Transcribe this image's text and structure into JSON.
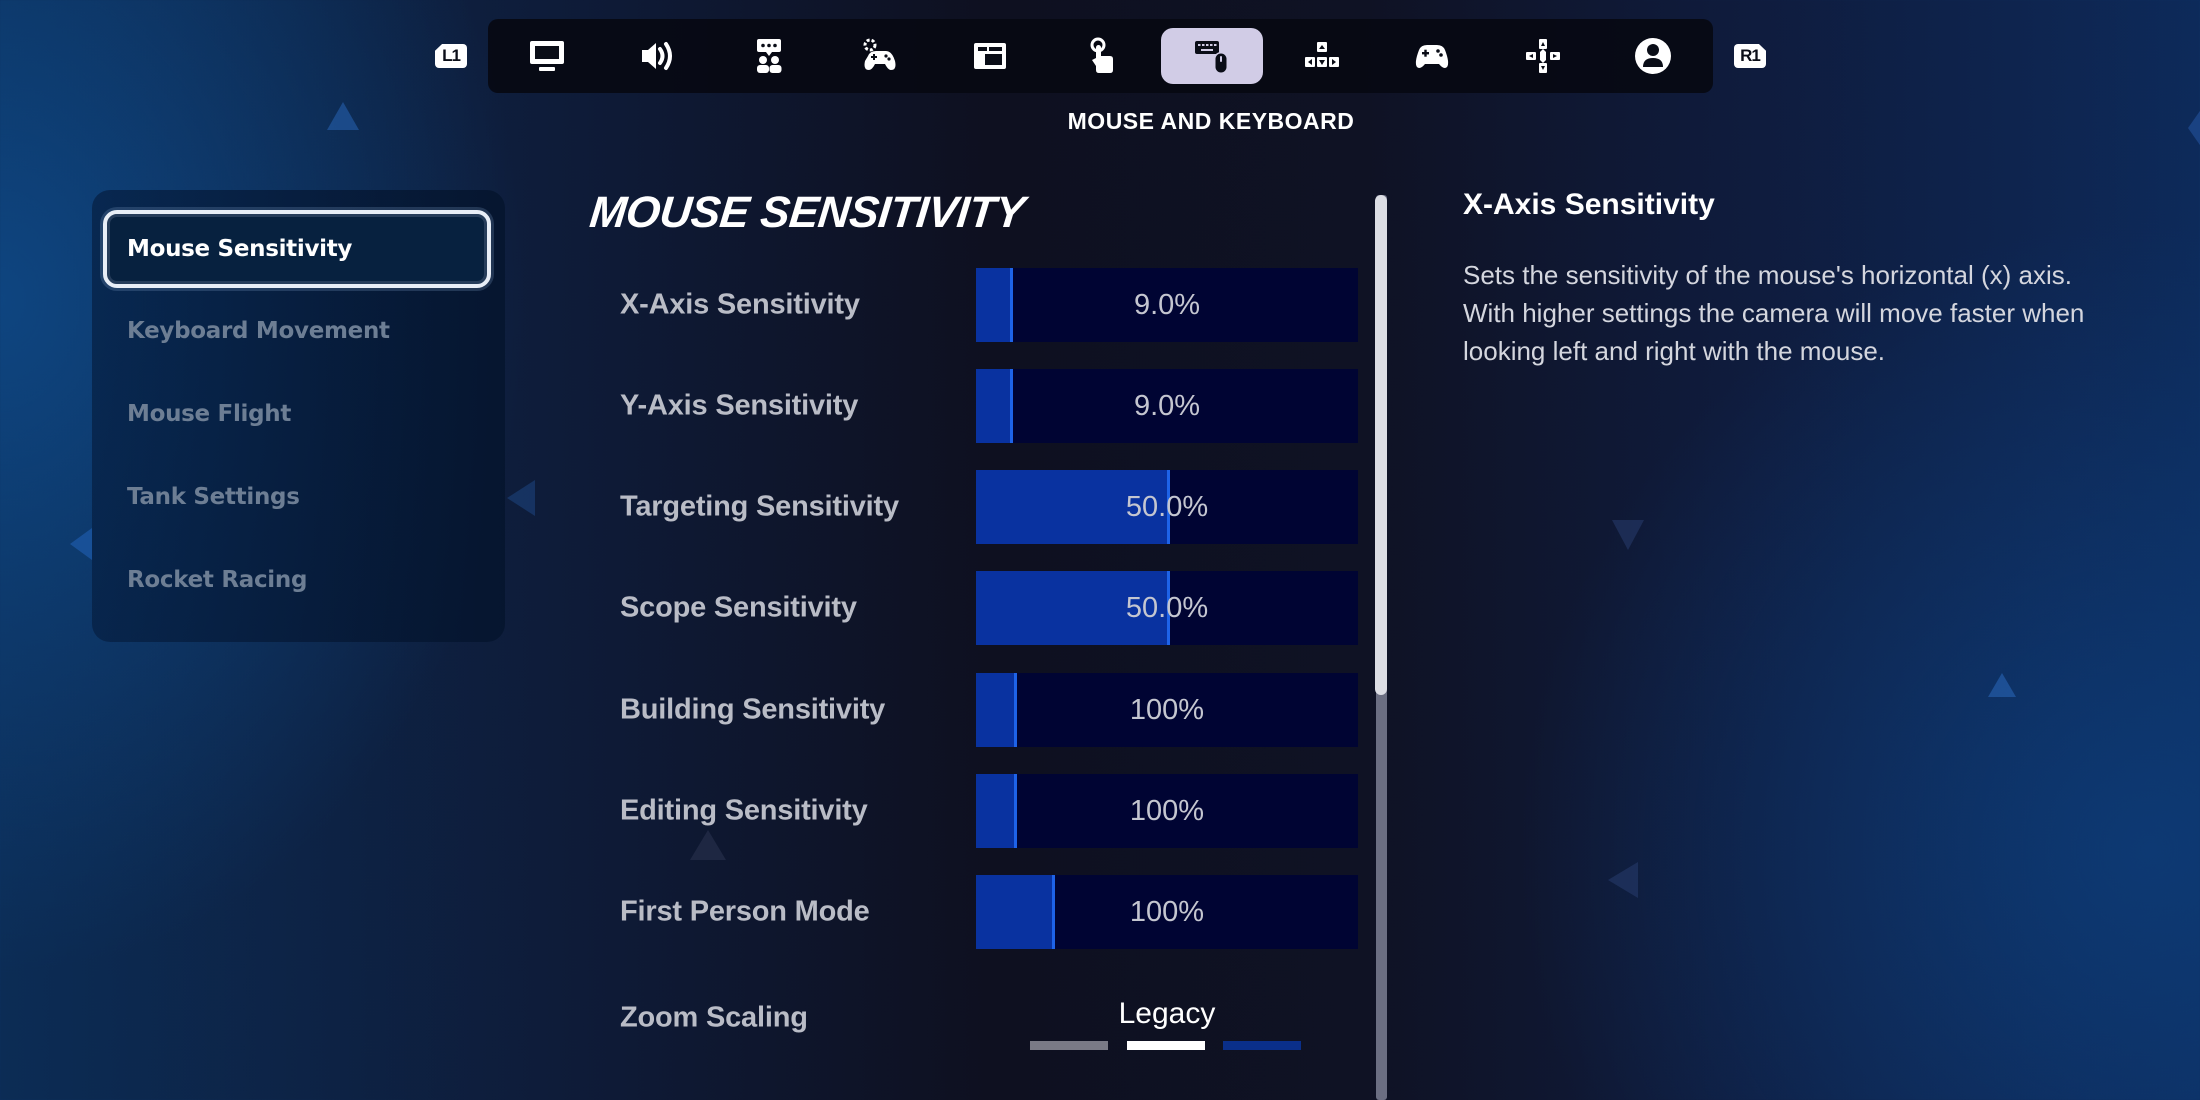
{
  "nav": {
    "left_shoulder": "L1",
    "right_shoulder": "R1",
    "tabs": [
      {
        "icon": "monitor-icon",
        "label": "Video",
        "active": false
      },
      {
        "icon": "speaker-icon",
        "label": "Audio",
        "active": false
      },
      {
        "icon": "accessibility-chat-icon",
        "label": "Accessibility",
        "active": false
      },
      {
        "icon": "controller-settings-icon",
        "label": "Game",
        "active": false
      },
      {
        "icon": "window-layout-icon",
        "label": "HUD",
        "active": false
      },
      {
        "icon": "touch-pointer-icon",
        "label": "Touch",
        "active": false
      },
      {
        "icon": "keyboard-mouse-icon",
        "label": "Mouse and Keyboard",
        "active": true
      },
      {
        "icon": "arrow-keys-icon",
        "label": "Keyboard Controls",
        "active": false
      },
      {
        "icon": "gamepad-icon",
        "label": "Controller",
        "active": false
      },
      {
        "icon": "dpad-icon",
        "label": "Controller Bindings",
        "active": false
      },
      {
        "icon": "account-icon",
        "label": "Account",
        "active": false
      }
    ],
    "active_title": "MOUSE AND KEYBOARD"
  },
  "sidebar": {
    "items": [
      {
        "label": "Mouse Sensitivity",
        "active": true
      },
      {
        "label": "Keyboard Movement",
        "active": false
      },
      {
        "label": "Mouse Flight",
        "active": false
      },
      {
        "label": "Tank Settings",
        "active": false
      },
      {
        "label": "Rocket Racing",
        "active": false
      }
    ]
  },
  "main": {
    "title": "MOUSE SENSITIVITY",
    "settings": [
      {
        "label": "X-Axis Sensitivity",
        "value": "9.0%",
        "fill": 0.09
      },
      {
        "label": "Y-Axis Sensitivity",
        "value": "9.0%",
        "fill": 0.09
      },
      {
        "label": "Targeting Sensitivity",
        "value": "50.0%",
        "fill": 0.5
      },
      {
        "label": "Scope Sensitivity",
        "value": "50.0%",
        "fill": 0.5
      },
      {
        "label": "Building Sensitivity",
        "value": "100%",
        "fill": 0.1
      },
      {
        "label": "Editing Sensitivity",
        "value": "100%",
        "fill": 0.1
      },
      {
        "label": "First Person Mode",
        "value": "100%",
        "fill": 0.2
      }
    ],
    "zoom_scaling": {
      "label": "Zoom Scaling",
      "value": "Legacy",
      "options_count": 3,
      "selected_index": 1
    },
    "scroll_fraction_visible": 0.55
  },
  "description": {
    "title": "X-Axis Sensitivity",
    "body": "Sets the sensitivity of the mouse's horizontal (x) axis. With higher settings the camera will move faster when looking left and right with the mouse."
  },
  "colors": {
    "slider_fill": "#0932a0",
    "slider_edge": "#1e63e8",
    "slider_track": "#000433",
    "active_tab_bg": "#d1cce6",
    "pip_inactive": "#7a7a86",
    "pip_selected": "#ffffff",
    "pip_next": "#0a2f8a"
  }
}
